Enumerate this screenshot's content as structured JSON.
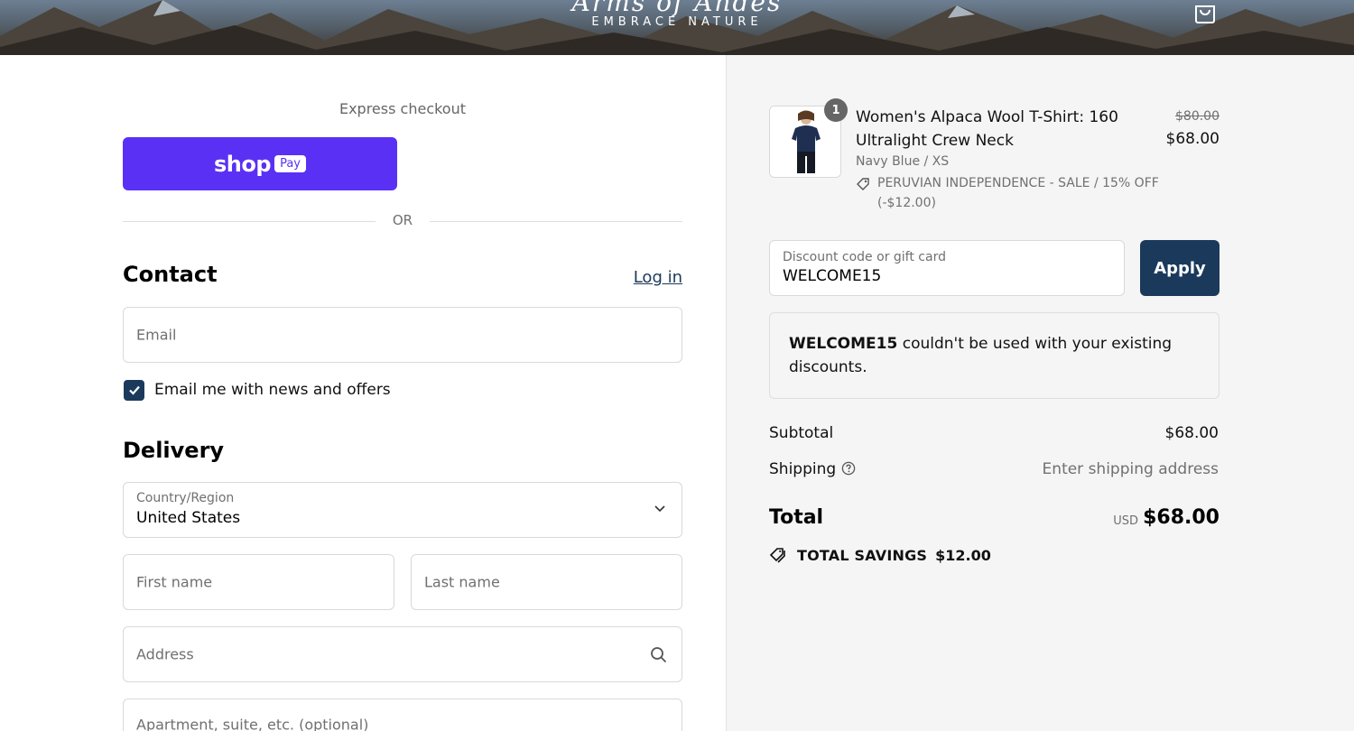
{
  "header": {
    "brand": "Arms of Andes",
    "tagline": "EMBRACE NATURE",
    "cart_icon": "shopping-bag-icon"
  },
  "checkout": {
    "express_title": "Express checkout",
    "shop_pay_word": "shop",
    "shop_pay_chip": "Pay",
    "or_label": "OR",
    "contact": {
      "title": "Contact",
      "login_link": "Log in",
      "email_placeholder": "Email",
      "newsletter_label": "Email me with news and offers",
      "newsletter_checked": true
    },
    "delivery": {
      "title": "Delivery",
      "country_label": "Country/Region",
      "country_value": "United States",
      "first_name_placeholder": "First name",
      "last_name_placeholder": "Last name",
      "address_placeholder": "Address",
      "apartment_placeholder": "Apartment, suite, etc. (optional)"
    }
  },
  "summary": {
    "item": {
      "quantity": "1",
      "name": "Women's Alpaca Wool T-Shirt: 160 Ultralight Crew Neck",
      "variant": "Navy Blue / XS",
      "discount_tag": "PERUVIAN INDEPENDENCE - SALE / 15% OFF (-$12.00)",
      "original_price": "$80.00",
      "price": "$68.00"
    },
    "discount": {
      "label": "Discount code or gift card",
      "value": "WELCOME15",
      "apply_label": "Apply",
      "error_code": "WELCOME15",
      "error_message": " couldn't be used with your existing discounts."
    },
    "subtotal_label": "Subtotal",
    "subtotal_value": "$68.00",
    "shipping_label": "Shipping",
    "shipping_value": "Enter shipping address",
    "total_label": "Total",
    "total_currency": "USD",
    "total_value": "$68.00",
    "savings_label": "TOTAL SAVINGS",
    "savings_value": "$12.00"
  },
  "colors": {
    "shop_pay": "#5a31f4",
    "accent": "#1b3a5b",
    "summary_bg": "#f5f5f5"
  }
}
